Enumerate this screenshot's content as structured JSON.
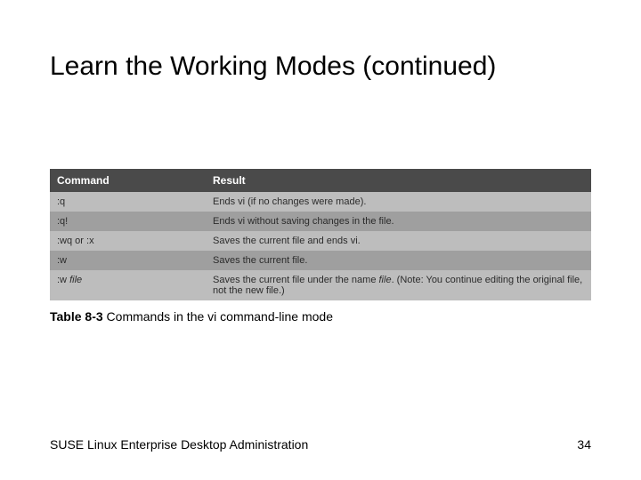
{
  "title": "Learn the Working Modes (continued)",
  "headers": {
    "command": "Command",
    "result": "Result"
  },
  "rows": [
    {
      "command": ":q",
      "result": "Ends vi (if no changes were made)."
    },
    {
      "command": ":q!",
      "result": "Ends vi without saving changes in the file."
    },
    {
      "command": ":wq or :x",
      "result": "Saves the current file and ends vi."
    },
    {
      "command": ":w",
      "result": "Saves the current file."
    },
    {
      "command_prefix": ":w ",
      "command_suffix": "file",
      "result_prefix": "Saves the current file under the name ",
      "result_mid": "file",
      "result_suffix": ". (Note: You continue editing the original file, not the new file.)"
    }
  ],
  "caption_label": "Table 8-3",
  "caption_text": " Commands in the vi command-line mode",
  "footer": "SUSE Linux Enterprise Desktop Administration",
  "page_number": "34"
}
